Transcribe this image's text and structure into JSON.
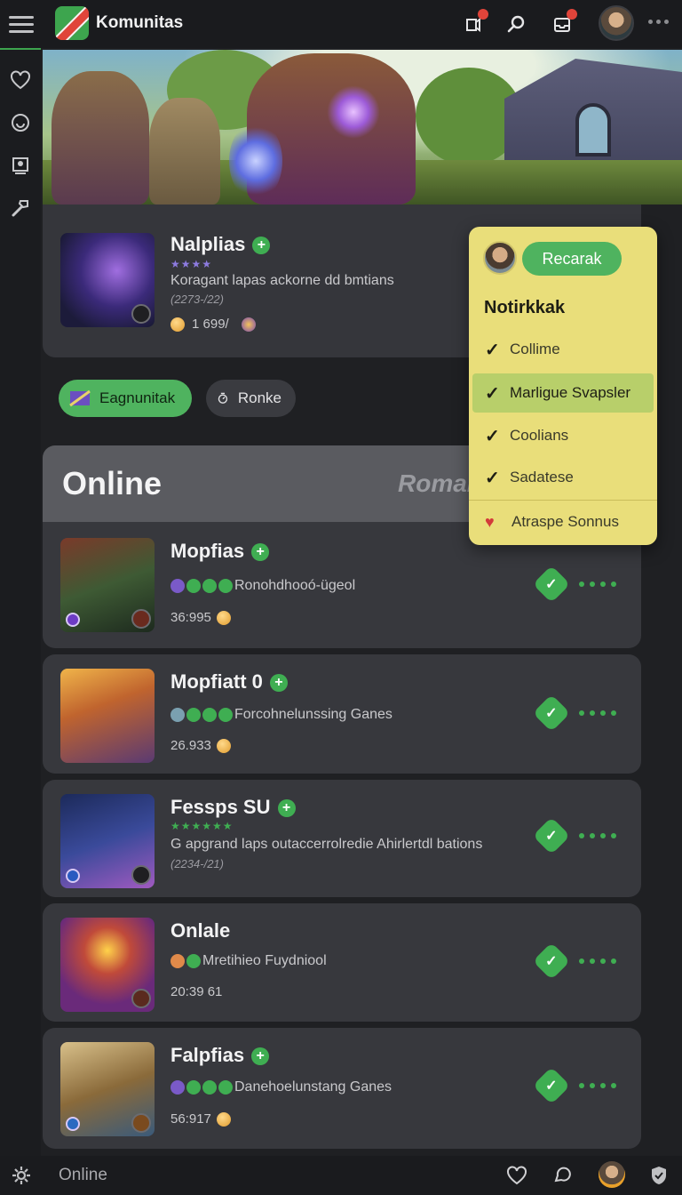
{
  "header": {
    "app_title": "Komunitas",
    "icons": [
      "menu-icon",
      "notification-icon",
      "search-icon",
      "inbox-icon",
      "avatar",
      "more-icon"
    ]
  },
  "sidebar": {
    "icons": [
      "heart-icon",
      "activity-icon",
      "portrait-icon",
      "tools-icon"
    ]
  },
  "featured": {
    "name": "Nalplias",
    "stars": "★★★★",
    "description": "Koragant lapas ackorne dd bmtians",
    "date": "(2273-/22)",
    "stat": "1 699/"
  },
  "chips": {
    "primary": "Eagnunitak",
    "secondary": "Ronke"
  },
  "online": {
    "title": "Online",
    "right_label": "Romal"
  },
  "rows": [
    {
      "name": "Mopfias",
      "desc": "Ronohdhooó-ügeol",
      "stat": "36:995"
    },
    {
      "name": "Mopfiatt 0",
      "desc": "Forcohnelunssing Ganes",
      "stat": "26.933"
    },
    {
      "name": "Fessps SU",
      "stars": "★★★★★★",
      "desc": "G apgrand laps outaccerrolredie Ahirlertdl bations",
      "date": "(2234-/21)"
    },
    {
      "name": "Onlale",
      "desc": "Mretihieo Fuydniool",
      "stat": "20:39 61"
    },
    {
      "name": "Falpfias",
      "desc": "Danehoelunstang Ganes",
      "stat": "56:917"
    }
  ],
  "dropdown": {
    "button": "Recarak",
    "heading": "Notirkkak",
    "items": [
      "Collime",
      "Marligue Svapsler",
      "Coolians",
      "Sadatese"
    ],
    "footer": "Atraspe Sonnus"
  },
  "bottom": {
    "label": "Online"
  },
  "colors": {
    "accent_green": "#3fae52",
    "dropdown_bg": "#e9de7a",
    "card_bg": "#37383d",
    "page_bg": "#1f2023"
  }
}
